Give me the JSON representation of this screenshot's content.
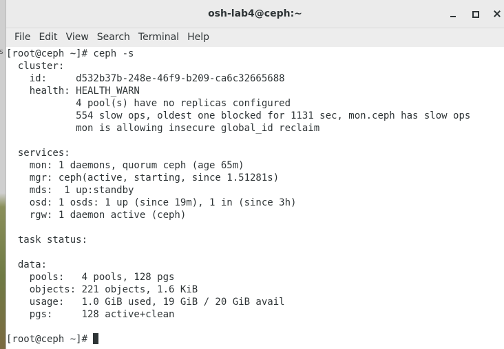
{
  "window": {
    "title": "osh-lab4@ceph:~"
  },
  "menubar": {
    "items": [
      "File",
      "Edit",
      "View",
      "Search",
      "Terminal",
      "Help"
    ]
  },
  "terminal": {
    "lines": [
      "[root@ceph ~]# ceph -s",
      "  cluster:",
      "    id:     d532b37b-248e-46f9-b209-ca6c32665688",
      "    health: HEALTH_WARN",
      "            4 pool(s) have no replicas configured",
      "            554 slow ops, oldest one blocked for 1131 sec, mon.ceph has slow ops",
      "            mon is allowing insecure global_id reclaim",
      "",
      "  services:",
      "    mon: 1 daemons, quorum ceph (age 65m)",
      "    mgr: ceph(active, starting, since 1.51281s)",
      "    mds:  1 up:standby",
      "    osd: 1 osds: 1 up (since 19m), 1 in (since 3h)",
      "    rgw: 1 daemon active (ceph)",
      "",
      "  task status:",
      "",
      "  data:",
      "    pools:   4 pools, 128 pgs",
      "    objects: 221 objects, 1.6 KiB",
      "    usage:   1.0 GiB used, 19 GiB / 20 GiB avail",
      "    pgs:     128 active+clean",
      ""
    ],
    "prompt": "[root@ceph ~]# "
  },
  "desktop": {
    "edge_fragment": "s"
  },
  "colors": {
    "terminal_bg": "#ffffff",
    "terminal_fg": "#2e3436",
    "titlebar_bg": "#ebebeb"
  }
}
